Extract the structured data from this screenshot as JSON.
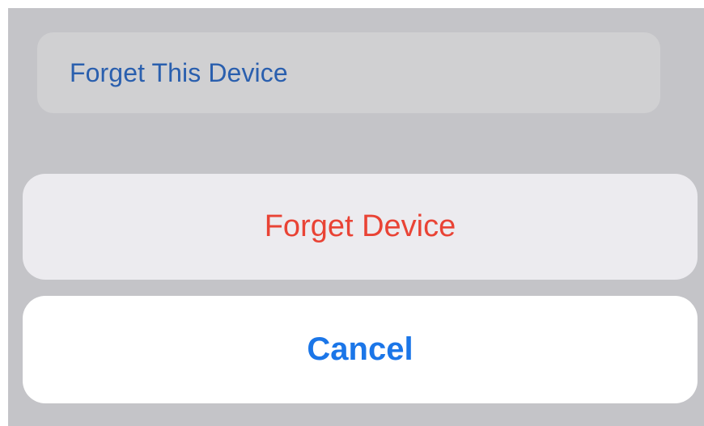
{
  "settings_row": {
    "label": "Forget This Device"
  },
  "action_sheet": {
    "destructive_label": "Forget Device",
    "cancel_label": "Cancel"
  },
  "colors": {
    "destructive": "#e94335",
    "accent_blue": "#1b76e8",
    "dimmed_link_blue": "#2a5fae",
    "backdrop_gray": "#c4c4c8"
  }
}
